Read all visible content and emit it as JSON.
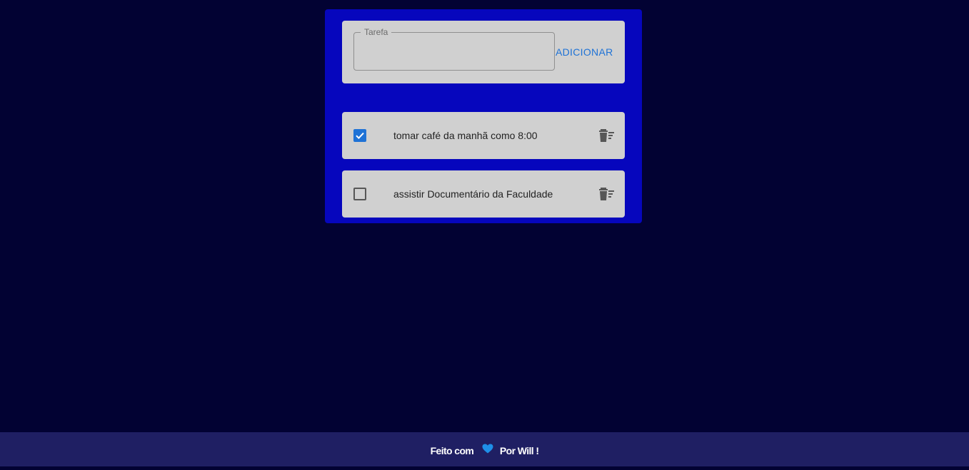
{
  "form": {
    "label": "Tarefa",
    "value": "",
    "add_label": "ADICIONAR"
  },
  "tasks": [
    {
      "text": "tomar café da manhã como 8:00",
      "done": true
    },
    {
      "text": "assistir Documentário da Faculdade",
      "done": false
    }
  ],
  "footer": {
    "made_with": "Feito com",
    "by": "Por Will !",
    "heart_icon": "heart-icon"
  },
  "colors": {
    "background": "#020233",
    "card": "#0606bd",
    "panel": "#d0d0d0",
    "accent": "#1e72d6",
    "footer": "#1f1f63"
  }
}
